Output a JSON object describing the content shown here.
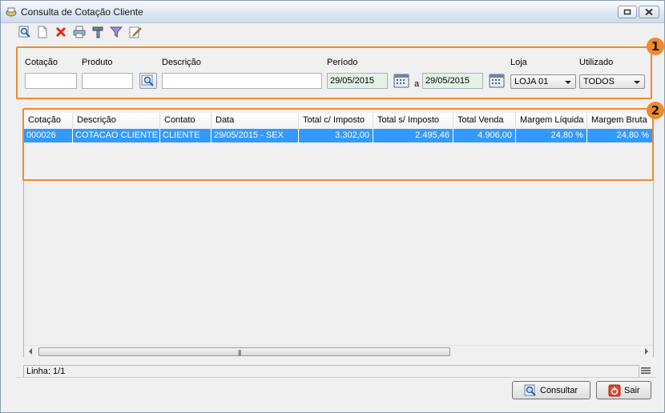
{
  "window": {
    "title": "Consulta de Cotação Cliente"
  },
  "toolbar": {
    "icons": [
      "search-doc-icon",
      "new-doc-icon",
      "delete-icon",
      "print-icon",
      "tools-icon",
      "filter-icon",
      "edit-icon"
    ]
  },
  "filters": {
    "callout": "1",
    "cotacao_label": "Cotação",
    "cotacao_value": "",
    "produto_label": "Produto",
    "produto_value": "",
    "descricao_label": "Descrição",
    "descricao_value": "",
    "periodo_label": "Período",
    "periodo_from": "29/05/2015",
    "periodo_sep": "a",
    "periodo_to": "29/05/2015",
    "loja_label": "Loja",
    "loja_value": "LOJA 01",
    "utilizado_label": "Utilizado",
    "utilizado_value": "TODOS"
  },
  "grid": {
    "callout": "2",
    "columns": [
      "Cotação",
      "Descrição",
      "Contato",
      "Data",
      "Total c/ Imposto",
      "Total s/ Imposto",
      "Total Venda",
      "Margem Líquida",
      "Margem Bruta"
    ],
    "rows": [
      [
        "000026",
        "COTACAO CLIENTE",
        "CLIENTE",
        "29/05/2015 - SEX",
        "3.302,00",
        "2.495,46",
        "4.906,00",
        "24,80 %",
        "24,80 %"
      ]
    ]
  },
  "status": {
    "linha": "Linha: 1/1"
  },
  "buttons": {
    "consultar": "Consultar",
    "sair": "Sair"
  },
  "colors": {
    "accent": "#f08a2c",
    "selection": "#3399ff",
    "date_field": "#e2f3e6"
  }
}
